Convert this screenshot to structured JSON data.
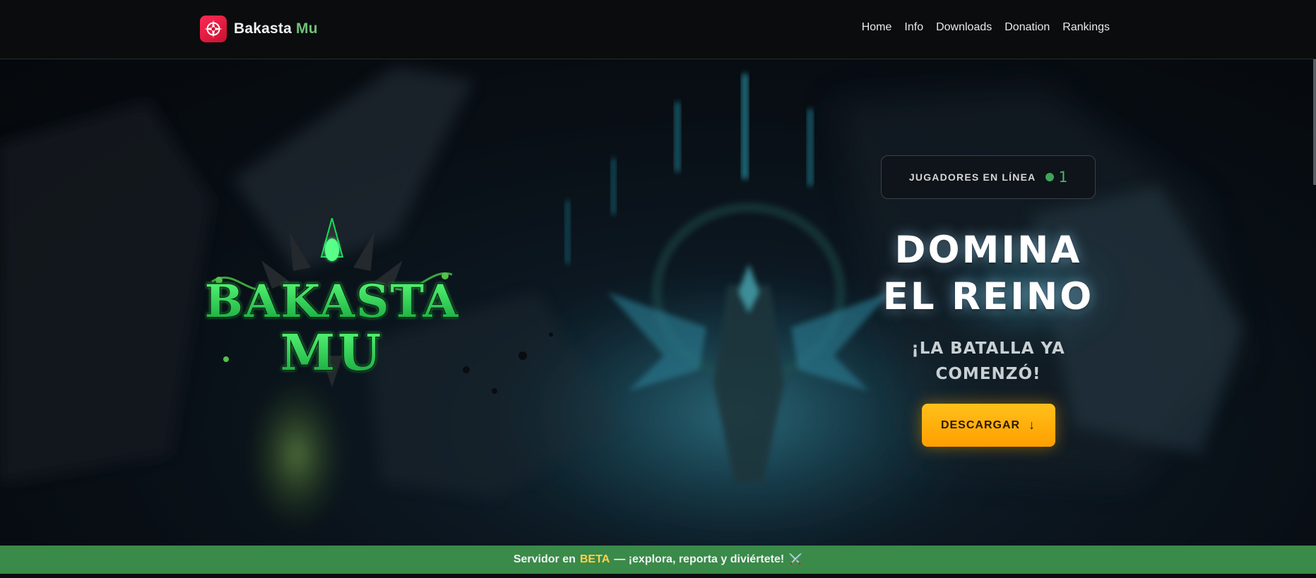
{
  "header": {
    "brand": {
      "name": "Bakasta",
      "accent": "Mu",
      "logo_icon": "compass-star-icon"
    },
    "nav": [
      {
        "label": "Home"
      },
      {
        "label": "Info"
      },
      {
        "label": "Downloads"
      },
      {
        "label": "Donation"
      },
      {
        "label": "Rankings"
      }
    ]
  },
  "hero": {
    "game_logo": {
      "line1": "BAKASTA",
      "line2": "MU"
    },
    "online": {
      "label": "JUGADORES EN LÍNEA",
      "count": "1",
      "status_color": "#3fa45a"
    },
    "title": {
      "line1": "DOMINA",
      "line2": "EL REINO"
    },
    "subtitle": "¡LA BATALLA YA COMENZÓ!",
    "download_button": {
      "label": "DESCARGAR",
      "icon": "arrow-down-icon",
      "arrow": "↓"
    }
  },
  "beta_banner": {
    "prefix": "Servidor en",
    "highlight": "BETA",
    "suffix": "— ¡explora, reporta y diviértete!",
    "icon": "crossed-swords-icon",
    "emoji": "⚔️"
  },
  "colors": {
    "accent_green": "#6fc27a",
    "button_yellow": "#ffb400",
    "banner_green": "#3a8a4a",
    "brand_red": "#e8163c"
  }
}
